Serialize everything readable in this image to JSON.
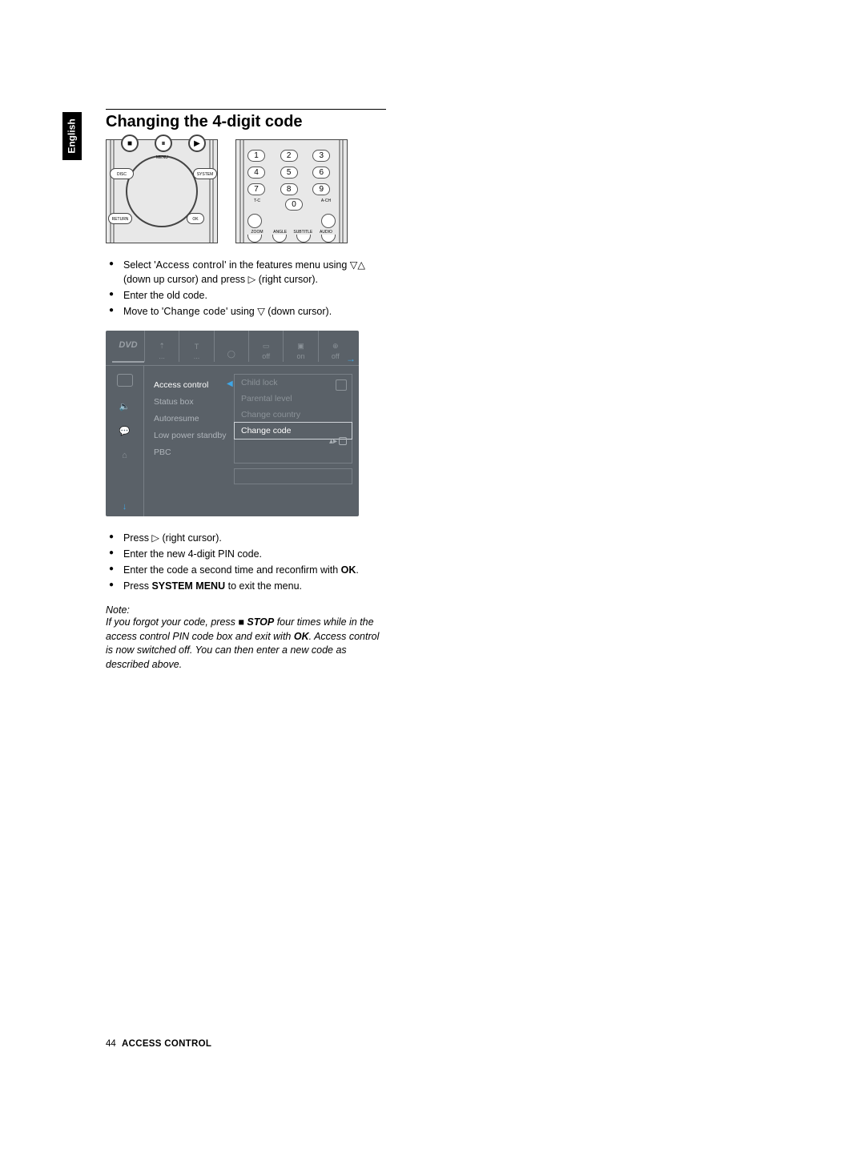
{
  "language_tab": "English",
  "title": "Changing the 4-digit code",
  "remote1": {
    "stop": "■",
    "pause": "⏸",
    "play": "▶",
    "menu_label": "MENU",
    "disc": "DISC",
    "system": "SYSTEM",
    "return": "RETURN",
    "ok": "OK"
  },
  "remote2": {
    "keys": [
      "1",
      "2",
      "3",
      "4",
      "5",
      "6",
      "7",
      "8",
      "9",
      "0"
    ],
    "tc": "T-C",
    "ach": "A-CH",
    "labels": [
      "ZOOM",
      "ANGLE",
      "SUBTITLE",
      "AUDIO"
    ]
  },
  "steps1": [
    {
      "pre": "Select '",
      "osd": "Access control",
      "post": "' in the features menu using ▽△ (down up cursor) and press ▷ (right cursor)."
    },
    {
      "text": "Enter the old code."
    },
    {
      "pre": "Move to '",
      "osd": "Change code",
      "post": "' using ▽ (down cursor)."
    }
  ],
  "osd": {
    "dvd_label": "DVD",
    "top_values": [
      "...",
      "...",
      "",
      "off",
      "on",
      "off"
    ],
    "left_items": [
      {
        "menu": "Access control",
        "sub": "Child lock",
        "selected_menu": true
      },
      {
        "menu": "Status box",
        "sub": "Parental level"
      },
      {
        "menu": "Autoresume",
        "sub": "Change country"
      },
      {
        "menu": "Low power standby",
        "sub": "Change code",
        "selected_sub": true
      },
      {
        "menu": "PBC"
      }
    ]
  },
  "steps2": [
    {
      "text": "Press ▷ (right cursor)."
    },
    {
      "text": "Enter the new 4-digit PIN code."
    },
    {
      "pre": "Enter the code a second time and reconfirm with ",
      "bold": "OK",
      "post": "."
    },
    {
      "pre": "Press ",
      "bold": "SYSTEM MENU",
      "post": " to exit the menu."
    }
  ],
  "note": {
    "header": "Note:",
    "l1a": "If you forgot your code, press ",
    "l1stop": "■ STOP",
    "l1b": " four times while in the access control PIN code box and exit with ",
    "l1ok": "OK",
    "l1c": ".  Access control is now switched off.  You can then enter a new code as described above."
  },
  "footer": {
    "page": "44",
    "section": "ACCESS CONTROL"
  }
}
